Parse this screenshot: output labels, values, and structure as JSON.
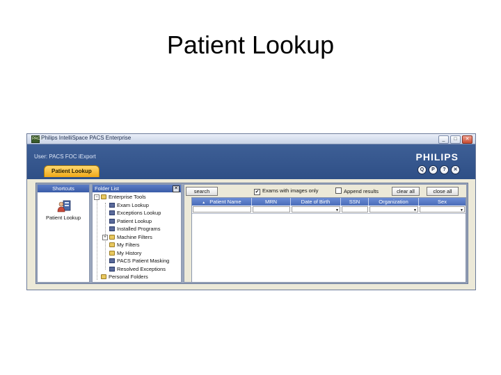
{
  "slide": {
    "title": "Patient Lookup"
  },
  "window": {
    "title": "Philips IntelliSpace PACS Enterprise",
    "icon_label": "PACS",
    "buttons": {
      "minimize": "_",
      "maximize": "□",
      "close": "✕"
    }
  },
  "header": {
    "user_label": "User: PACS FOC iExport",
    "logo": "PHILIPS",
    "round_buttons": [
      "Q",
      "P",
      "?",
      "✕"
    ],
    "active_tab": "Patient Lookup"
  },
  "shortcuts": {
    "heading": "Shortcuts",
    "items": [
      {
        "label": "Patient Lookup",
        "icon": "patient-lookup-icon"
      }
    ]
  },
  "folder_list": {
    "heading": "Folder List",
    "close": "✕",
    "tree": [
      {
        "label": "Enterprise Tools",
        "level": 0,
        "expander": "−",
        "icon": "folder-icon"
      },
      {
        "label": "Exam Lookup",
        "level": 1,
        "icon": "tool-icon"
      },
      {
        "label": "Exceptions Lookup",
        "level": 1,
        "icon": "tool-icon"
      },
      {
        "label": "Patient Lookup",
        "level": 1,
        "icon": "tool-icon"
      },
      {
        "label": "Installed Programs",
        "level": 1,
        "icon": "tool-icon"
      },
      {
        "label": "Machine Filters",
        "level": 1,
        "expander": "+",
        "icon": "folder-icon"
      },
      {
        "label": "My Filters",
        "level": 1,
        "icon": "folder-icon"
      },
      {
        "label": "My History",
        "level": 1,
        "icon": "folder-icon"
      },
      {
        "label": "PACS Patient Masking",
        "level": 1,
        "icon": "tool-icon"
      },
      {
        "label": "Resolved Exceptions",
        "level": 1,
        "icon": "tool-icon"
      },
      {
        "label": "Personal Folders",
        "level": 0,
        "icon": "folder-icon"
      }
    ]
  },
  "search_bar": {
    "search_label": "search",
    "exams_with_images_only": {
      "label": "Exams with images only",
      "checked": true,
      "mark": "✔"
    },
    "append_results": {
      "label": "Append results",
      "checked": false
    },
    "clear_all_label": "clear all",
    "close_all_label": "close all"
  },
  "results_grid": {
    "sort_indicator": "▲",
    "columns": [
      "Patient Name",
      "MRN",
      "Date of Birth",
      "SSN",
      "Organization",
      "Sex"
    ],
    "dropdown_mark": "▼",
    "rows": []
  }
}
